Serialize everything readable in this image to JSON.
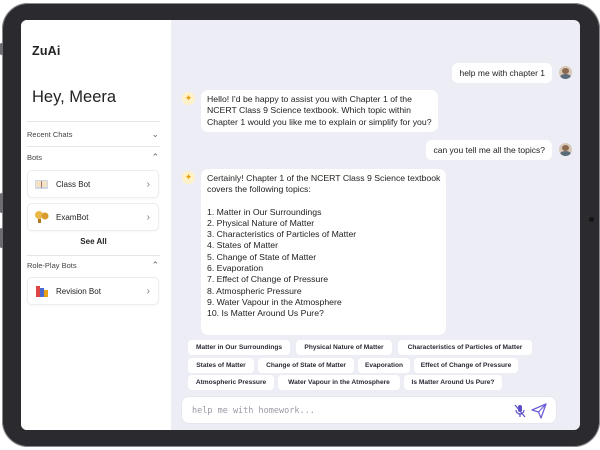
{
  "app": {
    "logo": "ZuAi",
    "greeting": "Hey, Meera"
  },
  "sidebar": {
    "recent_chats_label": "Recent Chats",
    "bots_label": "Bots",
    "bots": [
      {
        "label": "Class Bot",
        "icon": "book-icon"
      },
      {
        "label": "ExamBot",
        "icon": "trophy-icon"
      }
    ],
    "see_all": "See All",
    "roleplay_label": "Role-Play Bots",
    "roleplay_bots": [
      {
        "label": "Revision Bot",
        "icon": "books-stack-icon"
      }
    ]
  },
  "chat": {
    "user_msg_1": "help me with chapter 1",
    "bot_msg_1": [
      "Hello! I'd be happy to assist you with Chapter 1 of the",
      "NCERT Class 9 Science textbook. Which topic within",
      "Chapter 1 would you like me to explain or simplify for you?"
    ],
    "user_msg_2": "can you tell me all the topics?",
    "bot_msg_2_intro": [
      "Certainly! Chapter 1 of the NCERT Class 9 Science textbook",
      "covers the following topics:"
    ],
    "bot_msg_2_topics": [
      "1. Matter in Our Surroundings",
      "2. Physical Nature of Matter",
      "3. Characteristics of Particles of Matter",
      "4. States of Matter",
      "5. Change of State of Matter",
      "6. Evaporation",
      "7. Effect of Change of Pressure",
      "8. Atmospheric Pressure",
      "9. Water Vapour in the Atmosphere",
      "10. Is Matter Around Us Pure?"
    ]
  },
  "chips": [
    "Matter in Our Surroundings",
    "Physical Nature of Matter",
    "Characteristics of Particles of Matter",
    "States of Matter",
    "Change of State of Matter",
    "Evaporation",
    "Effect of Change of Pressure",
    "Atmospheric Pressure",
    "Water Vapour in the Atmosphere",
    "Is Matter Around Us Pure?"
  ],
  "input": {
    "placeholder": "help me with homework...",
    "value": ""
  },
  "colors": {
    "accent": "#e6a116",
    "send": "#6b5fd6",
    "screen_bg": "#edeef5"
  }
}
